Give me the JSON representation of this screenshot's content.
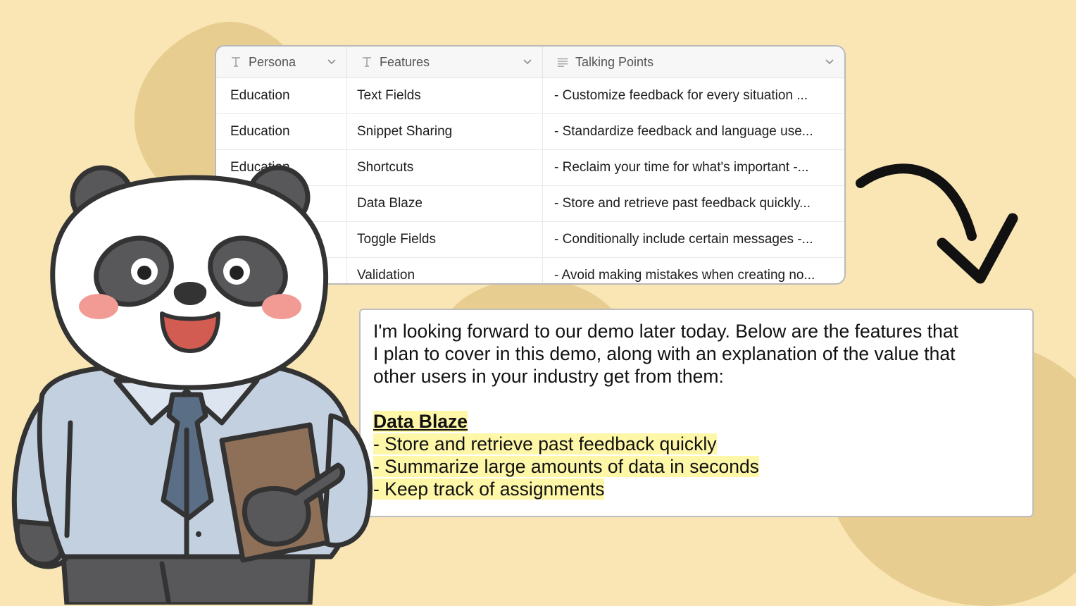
{
  "table": {
    "columns": [
      {
        "label": "Persona",
        "type_icon": "text-type-icon"
      },
      {
        "label": "Features",
        "type_icon": "text-type-icon"
      },
      {
        "label": "Talking Points",
        "type_icon": "long-text-icon"
      }
    ],
    "rows": [
      {
        "persona": "Education",
        "feature": "Text Fields",
        "talking": "- Customize feedback for every situation ..."
      },
      {
        "persona": "Education",
        "feature": "Snippet Sharing",
        "talking": "- Standardize feedback and language use..."
      },
      {
        "persona": "Education",
        "feature": "Shortcuts",
        "talking": "- Reclaim your time for what's important -..."
      },
      {
        "persona": "",
        "feature": "Data Blaze",
        "talking": "- Store and retrieve past feedback quickly..."
      },
      {
        "persona": "",
        "feature": "Toggle Fields",
        "talking": "- Conditionally include certain messages -..."
      },
      {
        "persona": "",
        "feature": "Validation",
        "talking": "- Avoid making mistakes when creating no..."
      }
    ]
  },
  "email": {
    "intro_line1": "I'm looking forward to our demo later today. Below are the features that",
    "intro_line2": "I plan to cover in this demo, along with an explanation of the value that",
    "intro_line3": "other users in your industry get from them:",
    "feature_title": "Data Blaze",
    "points": [
      "- Store and retrieve past feedback quickly",
      "- Summarize large amounts of data in seconds",
      "- Keep track of assignments"
    ]
  },
  "colors": {
    "background": "#F9E6B4",
    "blob": "#E8CD91",
    "highlight": "#FEF7A8",
    "panda_shirt": "#C3D0E0",
    "panda_tie": "#5A6E86",
    "clipboard": "#8E6F58"
  }
}
